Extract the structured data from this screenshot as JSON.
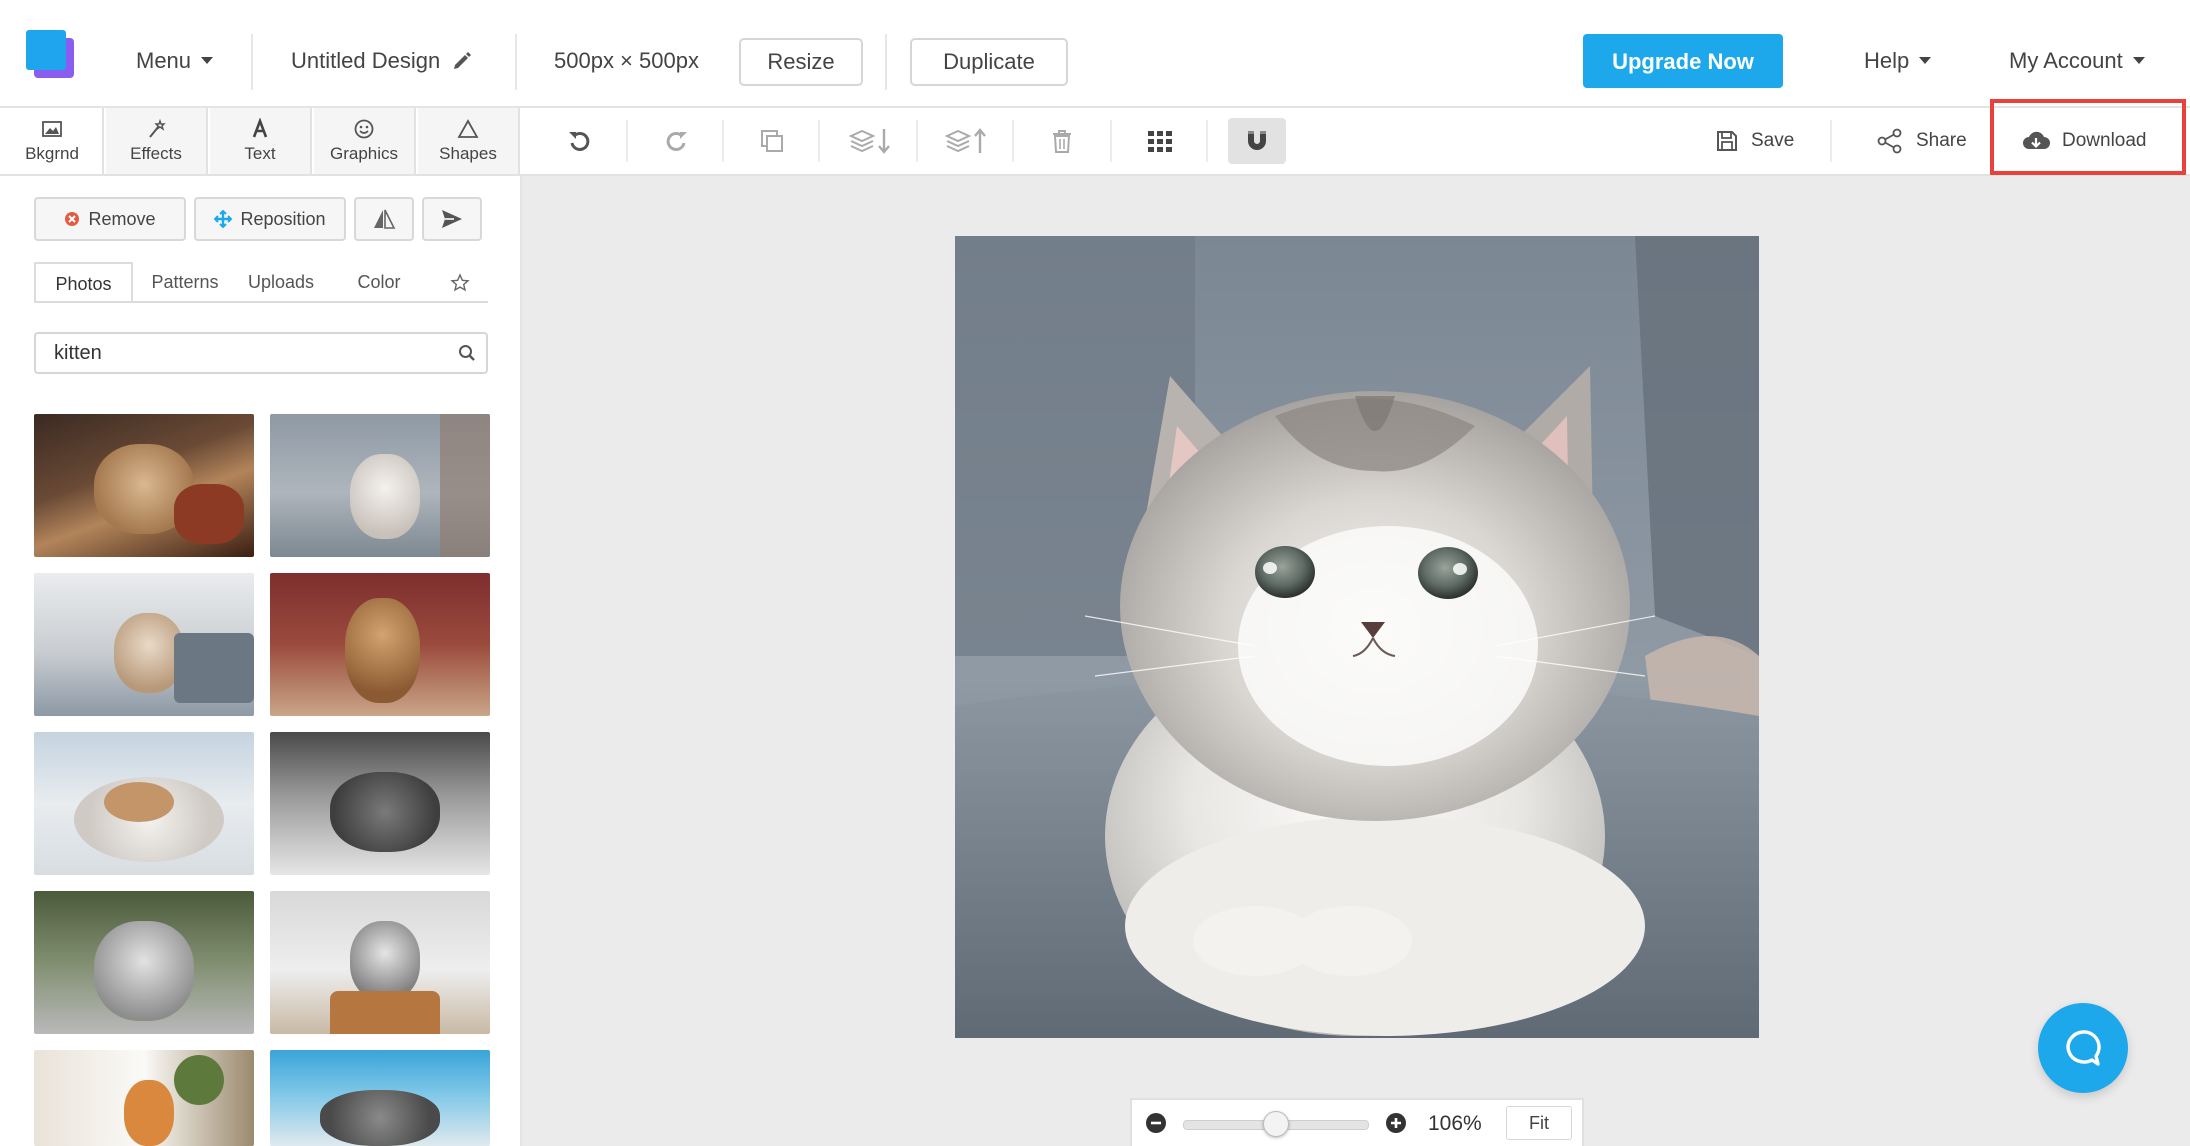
{
  "header": {
    "menu_label": "Menu",
    "design_title": "Untitled Design",
    "dimensions": "500px × 500px",
    "resize_label": "Resize",
    "duplicate_label": "Duplicate",
    "upgrade_label": "Upgrade Now",
    "help_label": "Help",
    "account_label": "My Account"
  },
  "side_tabs": [
    {
      "label": "Bkgrnd",
      "icon": "image-icon"
    },
    {
      "label": "Effects",
      "icon": "magic-wand-icon"
    },
    {
      "label": "Text",
      "icon": "text-icon"
    },
    {
      "label": "Graphics",
      "icon": "smiley-icon"
    },
    {
      "label": "Shapes",
      "icon": "triangle-icon"
    }
  ],
  "toolbar": {
    "tools": [
      "undo-icon",
      "redo-icon",
      "copy-icon",
      "layer-down-icon",
      "layer-up-icon",
      "trash-icon",
      "grid-icon",
      "magnet-icon"
    ],
    "save_label": "Save",
    "share_label": "Share",
    "download_label": "Download"
  },
  "panel": {
    "remove_label": "Remove",
    "reposition_label": "Reposition",
    "tabs": [
      "Photos",
      "Patterns",
      "Uploads",
      "Color"
    ],
    "active_tab": "Photos",
    "search_value": "kitten"
  },
  "zoom": {
    "value_label": "106%",
    "fit_label": "Fit",
    "slider_level": 0.5
  },
  "colors": {
    "accent": "#1ea8ec",
    "highlight": "#e8423c"
  }
}
